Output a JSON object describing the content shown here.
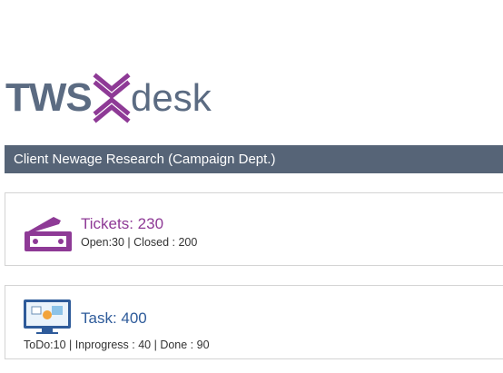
{
  "logo": {
    "part1": "TWS",
    "part2": "desk"
  },
  "header": {
    "title": "Client Newage Research (Campaign Dept.)"
  },
  "tickets": {
    "title": "Tickets: 230",
    "summary": "Open:30 | Closed : 200",
    "icon": "ticket-icon"
  },
  "tasks": {
    "title": "Task: 400",
    "summary": "ToDo:10 | Inprogress : 40 | Done : 90",
    "icon": "monitor-icon"
  },
  "colors": {
    "header_bg": "#566477",
    "logo_text": "#5b6b82",
    "logo_accent": "#8e3a96",
    "tickets_title": "#8e3a96",
    "task_title": "#2e5b9a"
  }
}
